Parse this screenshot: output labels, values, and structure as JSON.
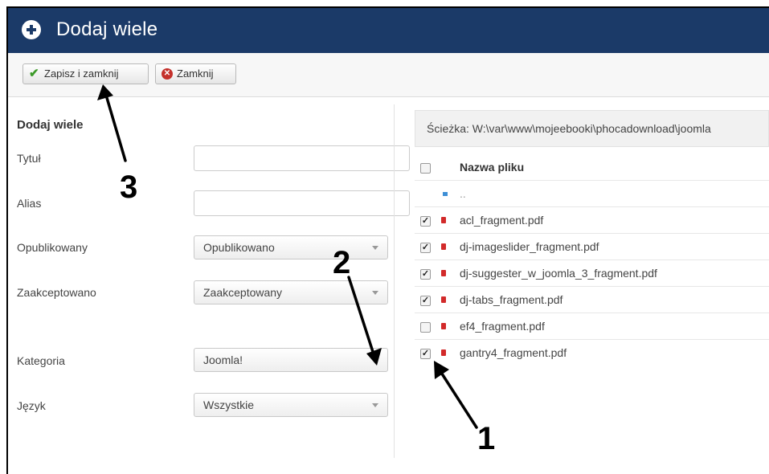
{
  "header": {
    "title": "Dodaj wiele"
  },
  "toolbar": {
    "save_label": "Zapisz i zamknij",
    "close_label": "Zamknij"
  },
  "form": {
    "section_title": "Dodaj wiele",
    "fields": {
      "title": {
        "label": "Tytuł",
        "value": ""
      },
      "alias": {
        "label": "Alias",
        "value": ""
      },
      "published": {
        "label": "Opublikowany",
        "value": "Opublikowano"
      },
      "approved": {
        "label": "Zaakceptowano",
        "value": "Zaakceptowany"
      },
      "category": {
        "label": "Kategoria",
        "value": "Joomla!"
      },
      "language": {
        "label": "Język",
        "value": "Wszystkie"
      }
    }
  },
  "files": {
    "path": "Ścieżka: W:\\var\\www\\mojeebooki\\phocadownload\\joomla",
    "column_header": "Nazwa pliku",
    "parent": "..",
    "rows": [
      {
        "name": "acl_fragment.pdf",
        "checked": true
      },
      {
        "name": "dj-imageslider_fragment.pdf",
        "checked": true
      },
      {
        "name": "dj-suggester_w_joomla_3_fragment.pdf",
        "checked": true
      },
      {
        "name": "dj-tabs_fragment.pdf",
        "checked": true
      },
      {
        "name": "ef4_fragment.pdf",
        "checked": false
      },
      {
        "name": "gantry4_fragment.pdf",
        "checked": true
      }
    ]
  },
  "annotations": {
    "n1": "1",
    "n2": "2",
    "n3": "3"
  },
  "colors": {
    "header_bg": "#1b3a68",
    "save_icon": "#3c9a29",
    "close_icon": "#c4302b"
  }
}
